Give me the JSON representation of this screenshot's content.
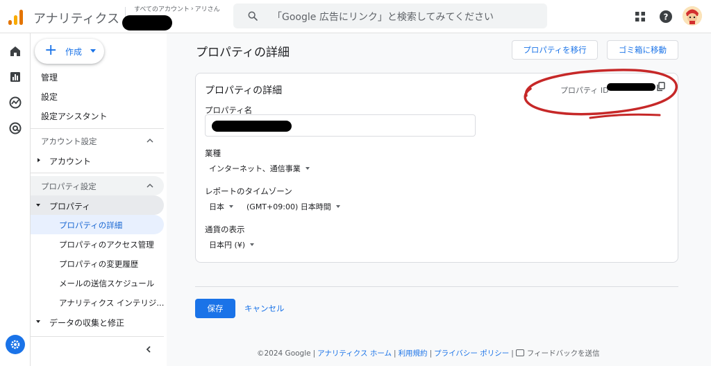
{
  "header": {
    "app_title": "アナリティクス",
    "breadcrumb_all": "すべてのアカウント",
    "breadcrumb_separator": "›",
    "breadcrumb_account": "アリさん",
    "search_placeholder": "「Google 広告にリンク」と検索してみてください"
  },
  "nav": {
    "create_label": "作成",
    "top_items": [
      "管理",
      "設定",
      "設定アシスタント"
    ],
    "account_section": "アカウント設定",
    "account_item": "アカウント",
    "property_section": "プロパティ設定",
    "property_item": "プロパティ",
    "property_subitems": [
      "プロパティの詳細",
      "プロパティのアクセス管理",
      "プロパティの変更履歴",
      "メールの送信スケジュール",
      "アナリティクス インテリジ..."
    ],
    "data_item": "データの収集と修正"
  },
  "main": {
    "page_title": "プロパティの詳細",
    "move_button": "プロパティを移行",
    "trash_button": "ゴミ箱に移動",
    "card_title": "プロパティの詳細",
    "property_id_label": "プロパティ ID",
    "property_name_label": "プロパティ名",
    "industry_label": "業種",
    "industry_value": "インターネット、通信事業",
    "timezone_label": "レポートのタイムゾーン",
    "timezone_country": "日本",
    "timezone_value": "(GMT+09:00) 日本時間",
    "currency_label": "通貨の表示",
    "currency_value": "日本円 (¥)",
    "save_button": "保存",
    "cancel_button": "キャンセル"
  },
  "footer": {
    "copyright": "©2024 Google",
    "home_link": "アナリティクス ホーム",
    "terms_link": "利用規約",
    "privacy_link": "プライバシー ポリシー",
    "feedback": "フィードバックを送信",
    "separator": "|"
  },
  "colors": {
    "accent": "#1a73e8",
    "logo_orange": "#e37400",
    "logo_yellow": "#f9ab00",
    "annotation_red": "#c62828"
  }
}
